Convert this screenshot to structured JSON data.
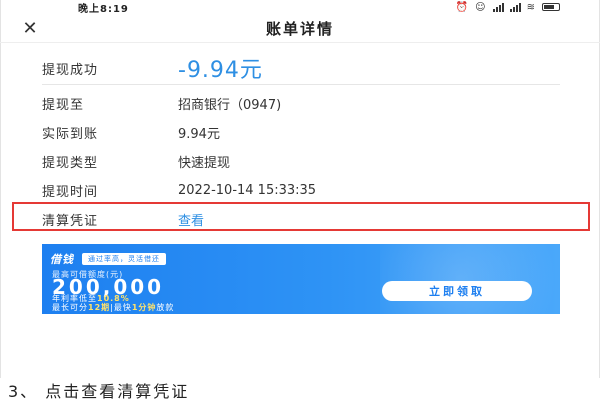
{
  "status_bar": {
    "time": "晚上8:19",
    "signal_text": "⋯"
  },
  "header": {
    "title": "账单详情",
    "close_icon": "close-icon"
  },
  "headline": {
    "label": "提现成功",
    "amount": "-9.94元"
  },
  "details": [
    {
      "label": "提现至",
      "value": "招商银行（0947)"
    },
    {
      "label": "实际到账",
      "value": "9.94元"
    },
    {
      "label": "提现类型",
      "value": "快速提现"
    },
    {
      "label": "提现时间",
      "value": "2022-10-14 15:33:35"
    }
  ],
  "voucher": {
    "label": "清算凭证",
    "link": "查看"
  },
  "banner": {
    "brand": "借钱",
    "slogan": "通过率高，灵活借还",
    "limit_label": "最高可借额度(元)",
    "limit_amount": "200,000",
    "rate_prefix": "年利率低至",
    "rate_value": "10.8%",
    "term_prefix": "最长可分",
    "term_value": "12期",
    "term_sep": "|最快",
    "speed_value": "1分钟",
    "speed_suffix": "放款",
    "button_label": "立即领取"
  },
  "caption": "3、 点击查看清算凭证",
  "colors": {
    "accent": "#2e8fe3",
    "highlight": "#e53935",
    "banner": "#1d7ff0"
  }
}
